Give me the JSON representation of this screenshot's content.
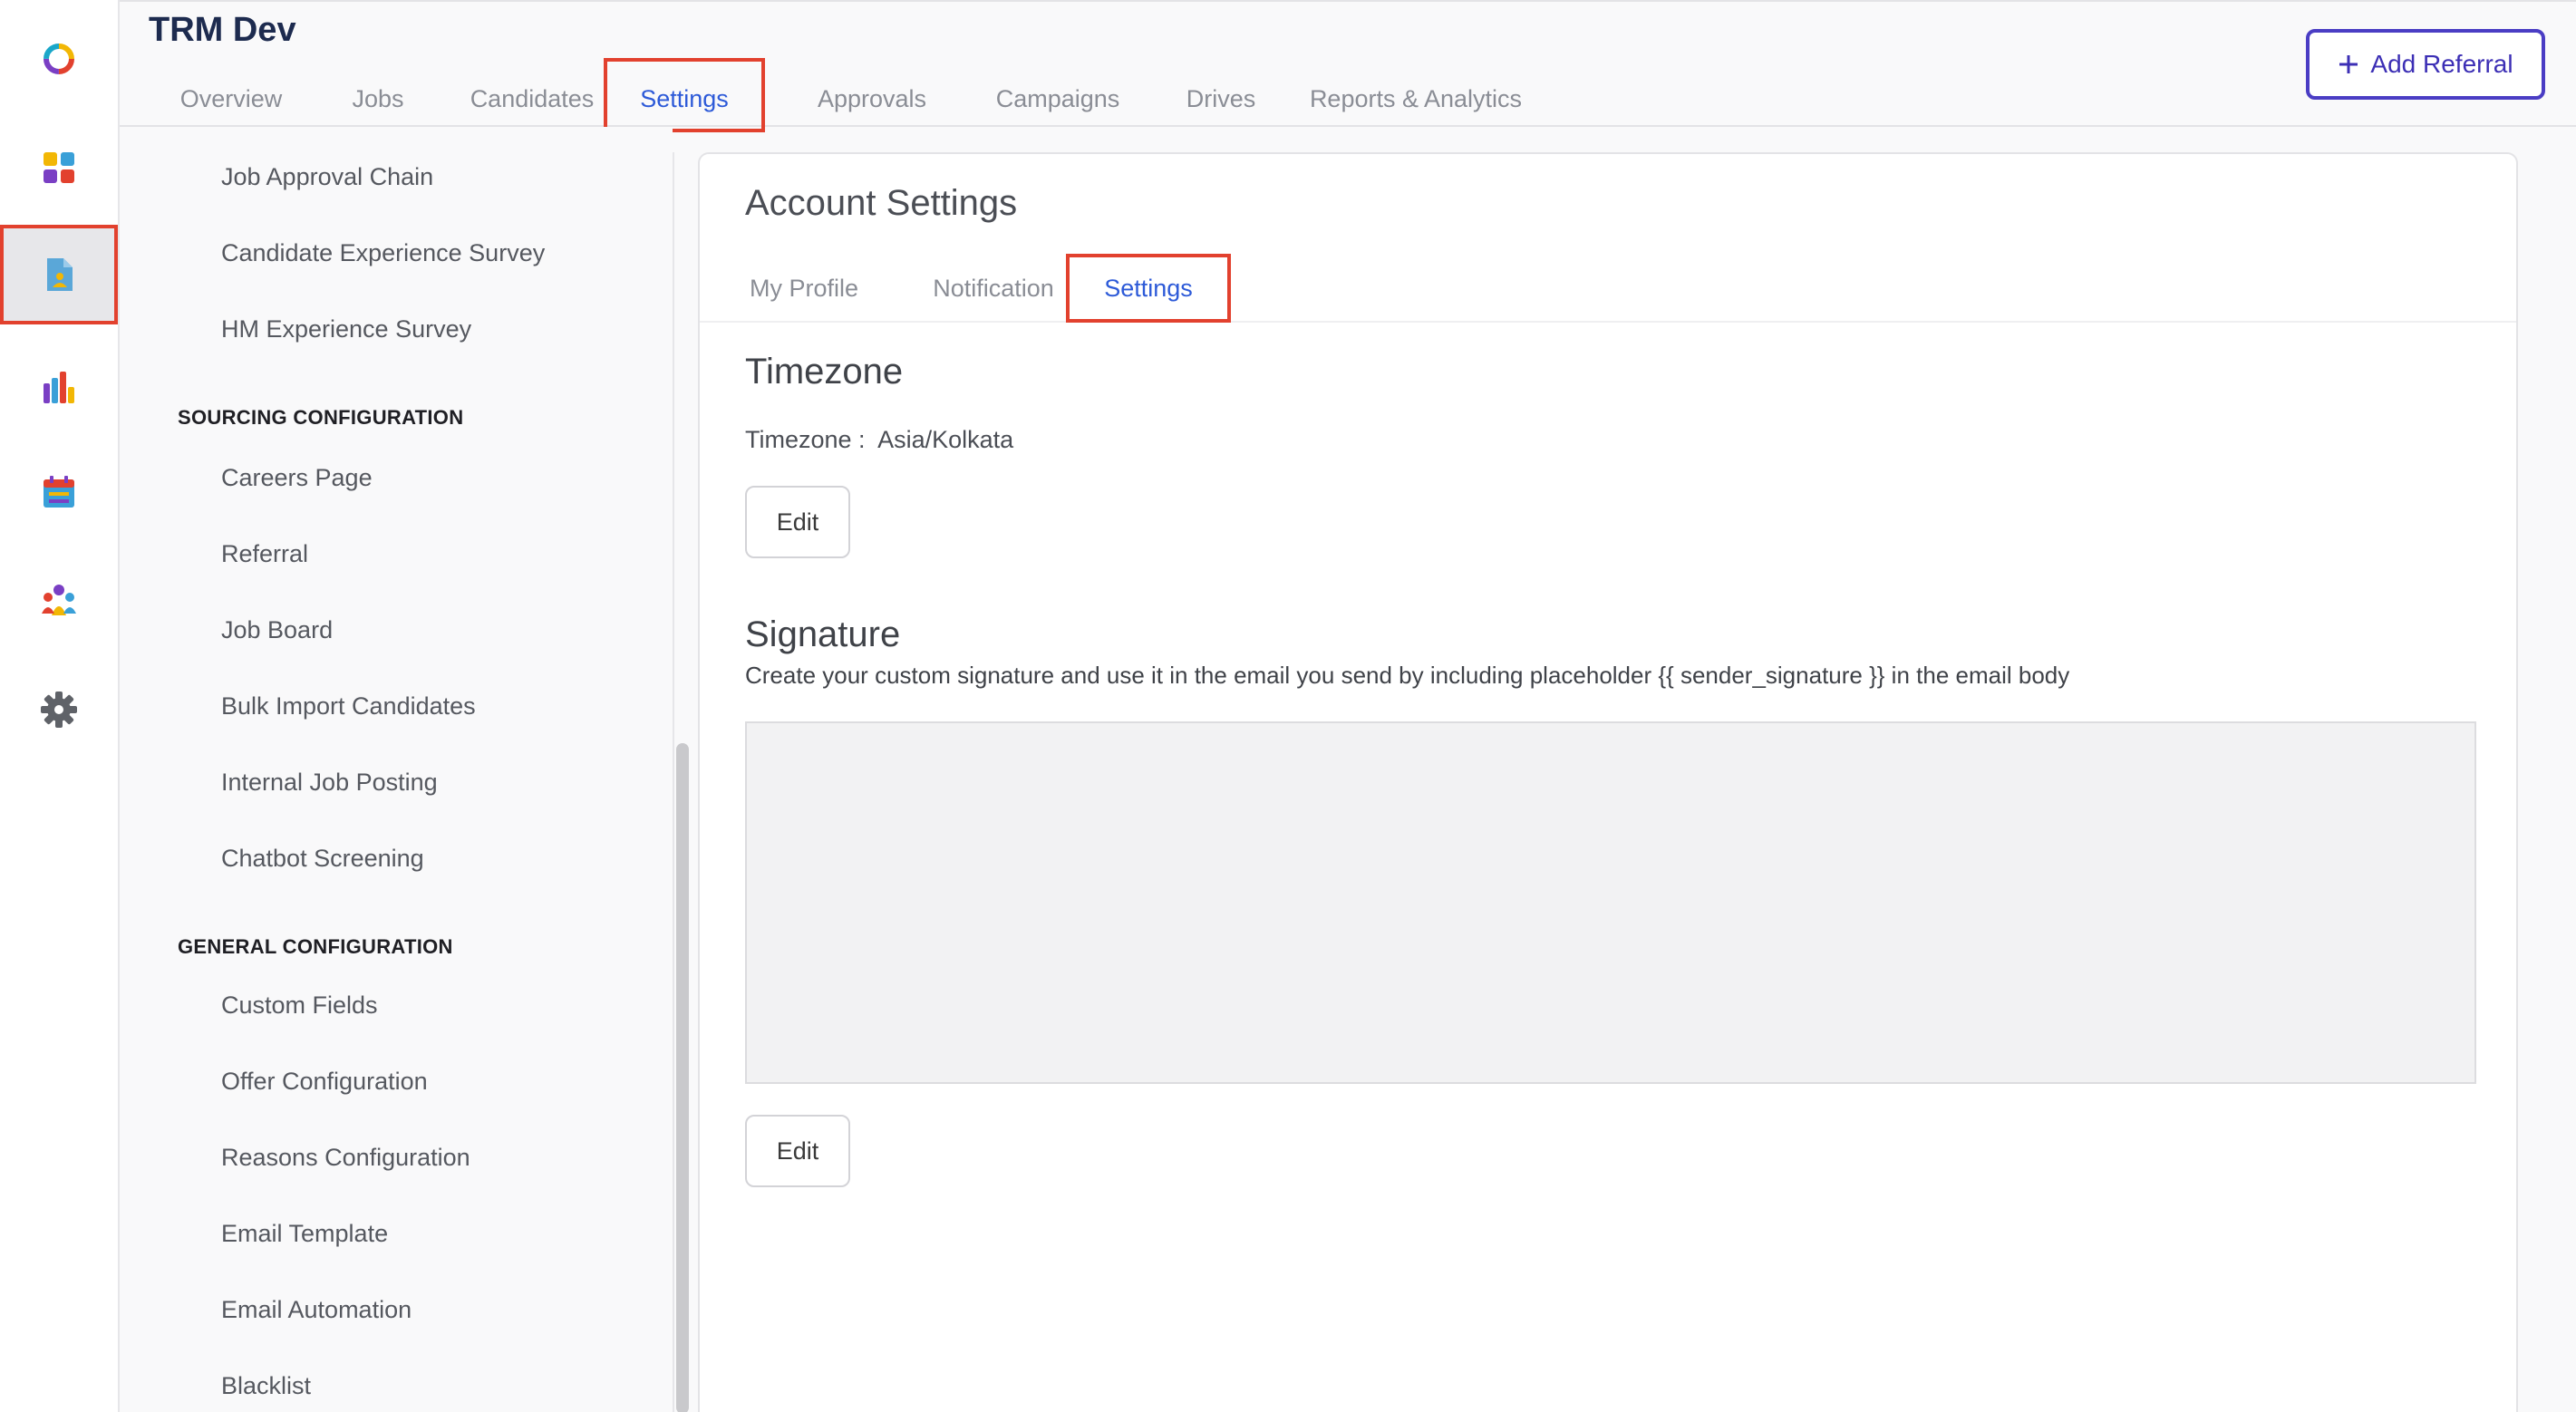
{
  "app": {
    "title": "TRM Dev"
  },
  "header": {
    "tabs": [
      {
        "label": "Overview"
      },
      {
        "label": "Jobs"
      },
      {
        "label": "Candidates"
      },
      {
        "label": "Settings"
      },
      {
        "label": "Approvals"
      },
      {
        "label": "Campaigns"
      },
      {
        "label": "Drives"
      },
      {
        "label": "Reports & Analytics"
      }
    ],
    "active_tab": "Settings",
    "add_referral": {
      "icon": "plus-icon",
      "label": "Add Referral"
    }
  },
  "rail": {
    "icons": [
      "logo-ring-icon",
      "apps-grid-icon",
      "candidate-document-icon",
      "bar-chart-icon",
      "calendar-icon",
      "team-icon",
      "gear-icon"
    ],
    "active": "candidate-document-icon"
  },
  "sidebar": {
    "items_top": [
      {
        "label": "Job Approval Chain"
      },
      {
        "label": "Candidate Experience Survey"
      },
      {
        "label": "HM Experience Survey"
      }
    ],
    "sourcing": {
      "heading": "SOURCING CONFIGURATION",
      "items": [
        {
          "label": "Careers Page"
        },
        {
          "label": "Referral"
        },
        {
          "label": "Job Board"
        },
        {
          "label": "Bulk Import Candidates"
        },
        {
          "label": "Internal Job Posting"
        },
        {
          "label": "Chatbot Screening"
        }
      ]
    },
    "general": {
      "heading": "GENERAL CONFIGURATION",
      "items": [
        {
          "label": "Custom Fields"
        },
        {
          "label": "Offer Configuration"
        },
        {
          "label": "Reasons Configuration"
        },
        {
          "label": "Email Template"
        },
        {
          "label": "Email Automation"
        },
        {
          "label": "Blacklist"
        }
      ]
    }
  },
  "account": {
    "title": "Account Settings",
    "tabs": [
      {
        "label": "My Profile"
      },
      {
        "label": "Notification"
      },
      {
        "label": "Settings"
      }
    ],
    "active_tab": "Settings",
    "timezone": {
      "heading": "Timezone",
      "label": "Timezone :",
      "value": "Asia/Kolkata",
      "edit_label": "Edit"
    },
    "signature": {
      "heading": "Signature",
      "description": "Create your custom signature and use it in the email you send by including placeholder {{ sender_signature }} in the email body",
      "value": "",
      "edit_label": "Edit"
    }
  },
  "colors": {
    "accent_blue": "#2d5ad8",
    "highlight_red": "#e2412e",
    "button_purple": "#4a3dc4",
    "title_navy": "#1d2b4f"
  }
}
